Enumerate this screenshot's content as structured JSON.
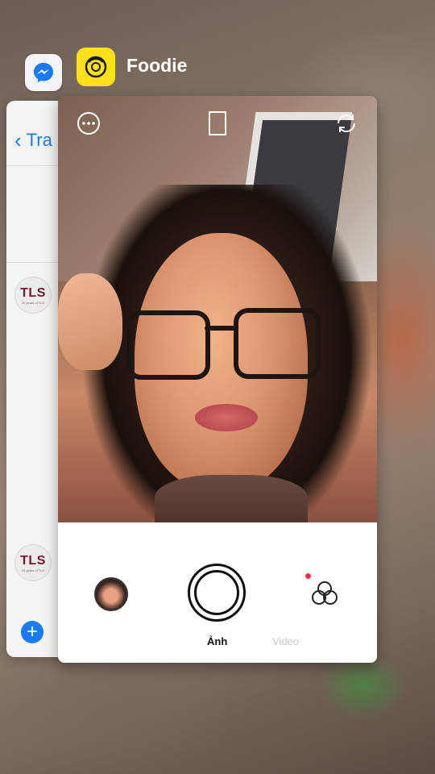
{
  "app_switcher": {
    "back_app": {
      "name": "Messenger",
      "icon": "messenger-icon",
      "back_label": "Tra",
      "avatars": [
        "TLS",
        "TLS"
      ],
      "avatar_subtext": "20 years of TLS",
      "compose_icon": "plus-icon"
    },
    "front_app": {
      "name": "Foodie",
      "icon": "foodie-icon"
    }
  },
  "camera": {
    "top_icons": [
      "more-icon",
      "aspect-ratio-icon",
      "switch-camera-icon"
    ],
    "modes": {
      "photo": "Ảnh",
      "video": "Video"
    },
    "active_mode": "photo",
    "gallery_icon": "gallery-thumbnail",
    "filter_icon": "filter-icon",
    "shutter_icon": "shutter-icon"
  },
  "colors": {
    "foodie_yellow": "#ffe01a",
    "messenger_blue": "#1a7af8",
    "filter_badge": "#f0304a"
  }
}
